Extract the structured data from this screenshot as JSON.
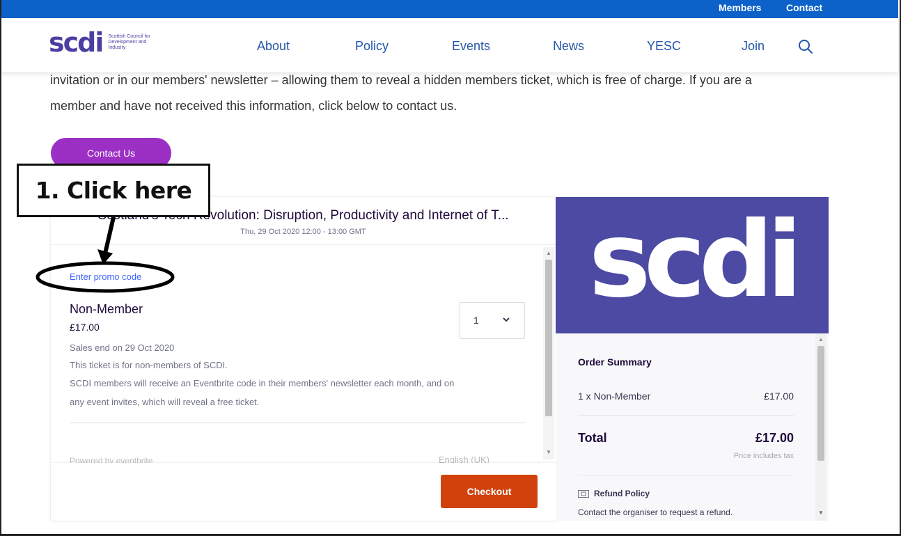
{
  "topbar": {
    "members": "Members",
    "contact": "Contact"
  },
  "header": {
    "logo_word": "scdi",
    "logo_sub": "Scottish Council for Development and Industry",
    "nav": [
      "About",
      "Policy",
      "Events",
      "News",
      "YESC",
      "Join"
    ]
  },
  "intro": {
    "line1": "invitation or in our members' newsletter – allowing them to reveal a hidden members ticket, which is free of charge. If you are a",
    "line2": "member and have not received this information, click below to contact us.",
    "contact_button": "Contact Us"
  },
  "annotation": {
    "label": "1. Click here"
  },
  "widget": {
    "event_title": "Scotland's Tech Revolution: Disruption, Productivity and Internet of T...",
    "event_date": "Thu, 29 Oct 2020 12:00 - 13:00 GMT",
    "promo_link": "Enter promo code",
    "ticket": {
      "name": "Non-Member",
      "price": "£17.00",
      "quantity": "1",
      "sales_end": "Sales end on 29 Oct 2020",
      "desc1": "This ticket is for non-members of SCDI.",
      "desc2": "SCDI members will receive an Eventbrite code in their members' newsletter each month, and on",
      "desc3": "any event invites, which will reveal a free ticket."
    },
    "powered_by": "Powered by eventbrite",
    "language": "English (UK)",
    "checkout_button": "Checkout",
    "banner_word": "scdi",
    "summary": {
      "heading": "Order Summary",
      "line_item": "1 x Non-Member",
      "line_price": "£17.00",
      "total_label": "Total",
      "total_price": "£17.00",
      "tax_note": "Price includes tax",
      "refund_title": "Refund Policy",
      "refund_text": "Contact the organiser to request a refund."
    }
  },
  "colors": {
    "topbar": "#0c62c9",
    "brand_purple": "#4a3fa0",
    "contact_button": "#9c2fc4",
    "checkout_button": "#d1410c",
    "banner": "#4d4aa3",
    "promo_link": "#3d64ff"
  }
}
